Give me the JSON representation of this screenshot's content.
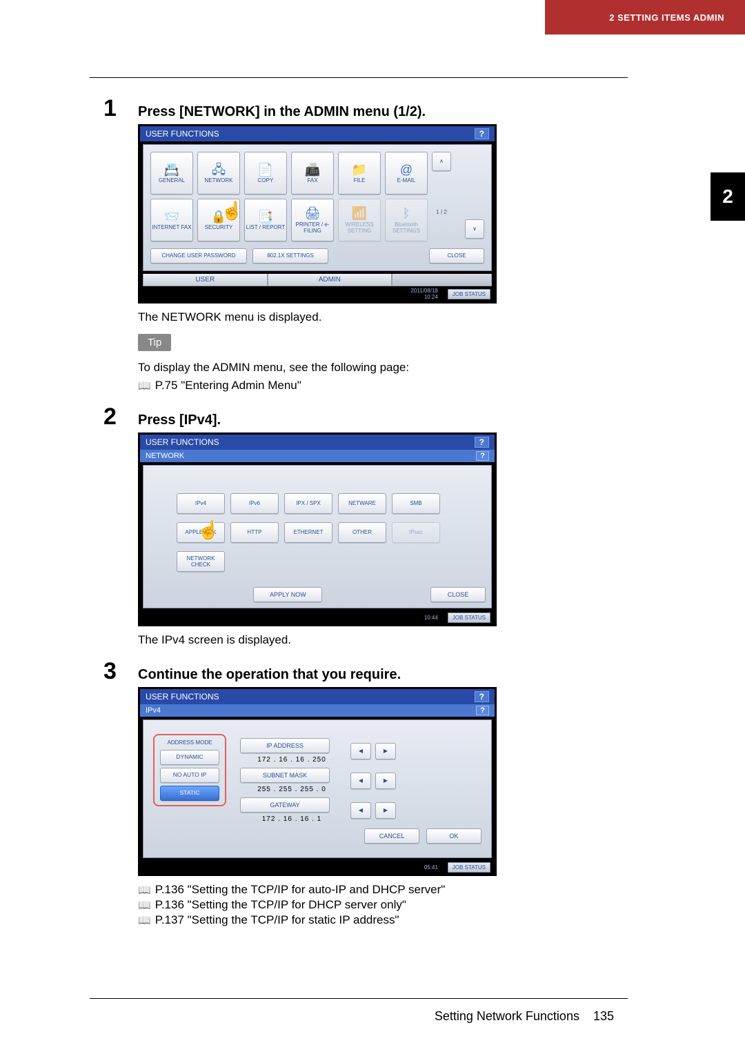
{
  "header": {
    "breadcrumb": "2 SETTING ITEMS ADMIN"
  },
  "chapter_tab": "2",
  "step1": {
    "num": "1",
    "title": "Press [NETWORK] in the ADMIN menu (1/2).",
    "caption": "The NETWORK menu is displayed.",
    "tip_label": "Tip",
    "tip_text": "To display the ADMIN menu, see the following page:",
    "tip_ref": "P.75 \"Entering Admin Menu\"",
    "screen": {
      "title": "USER FUNCTIONS",
      "row1": [
        "GENERAL",
        "NETWORK",
        "COPY",
        "FAX",
        "FILE",
        "E-MAIL"
      ],
      "row2": [
        "INTERNET FAX",
        "SECURITY",
        "LIST / REPORT",
        "PRINTER / e-FILING",
        "WIRELESS SETTING",
        "Bluetooth SETTINGS"
      ],
      "bottom": {
        "btn1": "CHANGE USER PASSWORD",
        "btn2": "802.1X SETTINGS",
        "btn3": "CLOSE"
      },
      "tabs": [
        "USER",
        "ADMIN"
      ],
      "scroll_up": "∧",
      "scroll_dn": "∨",
      "page_ind": "1 / 2",
      "timestamp": "2011/08/18\n10:24",
      "job": "JOB STATUS"
    }
  },
  "step2": {
    "num": "2",
    "title": "Press [IPv4].",
    "caption": "The IPv4 screen is displayed.",
    "screen": {
      "title": "USER FUNCTIONS",
      "sub": "NETWORK",
      "row1": [
        "IPv4",
        "IPv6",
        "IPX / SPX",
        "NETWARE",
        "SMB"
      ],
      "row2": [
        "APPLETALK",
        "HTTP",
        "ETHERNET",
        "OTHER",
        "IPsec"
      ],
      "row3": [
        "NETWORK CHECK"
      ],
      "bottom": {
        "btn1": "APPLY NOW",
        "btn2": "CLOSE"
      },
      "timestamp": "10:44",
      "job": "JOB STATUS"
    }
  },
  "step3": {
    "num": "3",
    "title": "Continue the operation that you require.",
    "screen": {
      "title": "USER FUNCTIONS",
      "sub": "IPv4",
      "mode_label": "ADDRESS MODE",
      "mode_opts": [
        "DYNAMIC",
        "NO AUTO IP",
        "STATIC"
      ],
      "fields": [
        {
          "label": "IP ADDRESS",
          "value": "172 . 16 . 16 . 250"
        },
        {
          "label": "SUBNET MASK",
          "value": "255 . 255 . 255 .  0"
        },
        {
          "label": "GATEWAY",
          "value": "172 . 16 . 16 .  1"
        }
      ],
      "bottom": {
        "btn1": "CANCEL",
        "btn2": "OK"
      },
      "timestamp": "05:41",
      "job": "JOB STATUS"
    },
    "refs": [
      "P.136 \"Setting the TCP/IP for auto-IP and DHCP server\"",
      "P.136 \"Setting the TCP/IP for DHCP server only\"",
      "P.137 \"Setting the TCP/IP for static IP address\""
    ]
  },
  "footer": {
    "section": "Setting Network Functions",
    "page": "135"
  },
  "glyphs": {
    "help": "?",
    "left": "◀",
    "right": "▶"
  }
}
